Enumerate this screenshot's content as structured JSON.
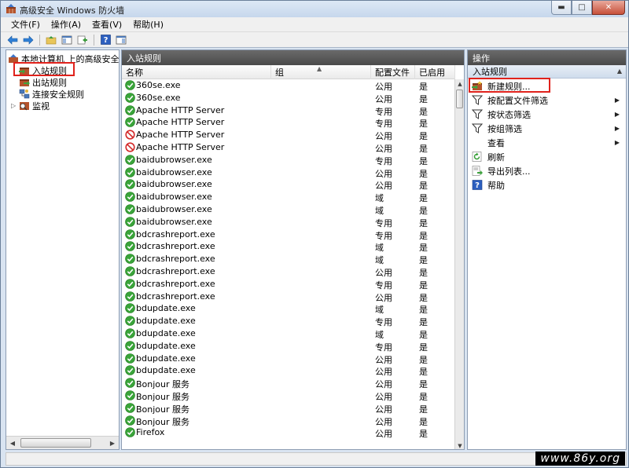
{
  "window": {
    "title": "高级安全 Windows 防火墙",
    "controls": {
      "minimize": "▬",
      "maximize": "□",
      "close": "✕"
    }
  },
  "menu": [
    "文件(F)",
    "操作(A)",
    "查看(V)",
    "帮助(H)"
  ],
  "toolbar_icons": [
    "back-icon",
    "forward-icon",
    "up-folder-icon",
    "console-tree-icon",
    "export-icon",
    "help-icon",
    "action-pane-icon"
  ],
  "tree": {
    "root": "本地计算机 上的高级安全 Windows 防火墙",
    "items": [
      {
        "label": "入站规则",
        "icon": "inbound-rules-icon"
      },
      {
        "label": "出站规则",
        "icon": "outbound-rules-icon"
      },
      {
        "label": "连接安全规则",
        "icon": "connection-security-icon"
      },
      {
        "label": "监视",
        "icon": "monitor-icon"
      }
    ]
  },
  "middle": {
    "header": "入站规则",
    "columns": {
      "name": "名称",
      "group": "组",
      "profile": "配置文件",
      "enabled": "已启用"
    },
    "rows": [
      {
        "status": "allow",
        "name": "360se.exe",
        "profile": "公用",
        "enabled": "是"
      },
      {
        "status": "allow",
        "name": "360se.exe",
        "profile": "公用",
        "enabled": "是"
      },
      {
        "status": "allow",
        "name": "Apache HTTP Server",
        "profile": "专用",
        "enabled": "是"
      },
      {
        "status": "allow",
        "name": "Apache HTTP Server",
        "profile": "专用",
        "enabled": "是"
      },
      {
        "status": "block",
        "name": "Apache HTTP Server",
        "profile": "公用",
        "enabled": "是"
      },
      {
        "status": "block",
        "name": "Apache HTTP Server",
        "profile": "公用",
        "enabled": "是"
      },
      {
        "status": "allow",
        "name": "baidubrowser.exe",
        "profile": "专用",
        "enabled": "是"
      },
      {
        "status": "allow",
        "name": "baidubrowser.exe",
        "profile": "公用",
        "enabled": "是"
      },
      {
        "status": "allow",
        "name": "baidubrowser.exe",
        "profile": "公用",
        "enabled": "是"
      },
      {
        "status": "allow",
        "name": "baidubrowser.exe",
        "profile": "域",
        "enabled": "是"
      },
      {
        "status": "allow",
        "name": "baidubrowser.exe",
        "profile": "域",
        "enabled": "是"
      },
      {
        "status": "allow",
        "name": "baidubrowser.exe",
        "profile": "专用",
        "enabled": "是"
      },
      {
        "status": "allow",
        "name": "bdcrashreport.exe",
        "profile": "专用",
        "enabled": "是"
      },
      {
        "status": "allow",
        "name": "bdcrashreport.exe",
        "profile": "域",
        "enabled": "是"
      },
      {
        "status": "allow",
        "name": "bdcrashreport.exe",
        "profile": "域",
        "enabled": "是"
      },
      {
        "status": "allow",
        "name": "bdcrashreport.exe",
        "profile": "公用",
        "enabled": "是"
      },
      {
        "status": "allow",
        "name": "bdcrashreport.exe",
        "profile": "专用",
        "enabled": "是"
      },
      {
        "status": "allow",
        "name": "bdcrashreport.exe",
        "profile": "公用",
        "enabled": "是"
      },
      {
        "status": "allow",
        "name": "bdupdate.exe",
        "profile": "域",
        "enabled": "是"
      },
      {
        "status": "allow",
        "name": "bdupdate.exe",
        "profile": "专用",
        "enabled": "是"
      },
      {
        "status": "allow",
        "name": "bdupdate.exe",
        "profile": "域",
        "enabled": "是"
      },
      {
        "status": "allow",
        "name": "bdupdate.exe",
        "profile": "专用",
        "enabled": "是"
      },
      {
        "status": "allow",
        "name": "bdupdate.exe",
        "profile": "公用",
        "enabled": "是"
      },
      {
        "status": "allow",
        "name": "bdupdate.exe",
        "profile": "公用",
        "enabled": "是"
      },
      {
        "status": "allow",
        "name": "Bonjour 服务",
        "profile": "公用",
        "enabled": "是"
      },
      {
        "status": "allow",
        "name": "Bonjour 服务",
        "profile": "公用",
        "enabled": "是"
      },
      {
        "status": "allow",
        "name": "Bonjour 服务",
        "profile": "公用",
        "enabled": "是"
      },
      {
        "status": "allow",
        "name": "Bonjour 服务",
        "profile": "公用",
        "enabled": "是"
      },
      {
        "status": "allow",
        "name": "Firefox",
        "profile": "公用",
        "enabled": "是"
      }
    ]
  },
  "actions": {
    "header": "操作",
    "section": "入站规则",
    "items": [
      {
        "label": "新建规则...",
        "icon": "new-rule-icon",
        "submenu": false
      },
      {
        "label": "按配置文件筛选",
        "icon": "filter-icon",
        "submenu": true
      },
      {
        "label": "按状态筛选",
        "icon": "filter-icon",
        "submenu": true
      },
      {
        "label": "按组筛选",
        "icon": "filter-icon",
        "submenu": true
      },
      {
        "label": "查看",
        "icon": "",
        "submenu": true
      },
      {
        "label": "刷新",
        "icon": "refresh-icon",
        "submenu": false
      },
      {
        "label": "导出列表...",
        "icon": "export-list-icon",
        "submenu": false
      },
      {
        "label": "帮助",
        "icon": "help-icon",
        "submenu": false
      }
    ]
  },
  "watermark": "www.86y.org",
  "colors": {
    "highlight": "#e0221c",
    "allow": "#3aa43a",
    "block": "#d32a2a",
    "header": "#555555"
  }
}
